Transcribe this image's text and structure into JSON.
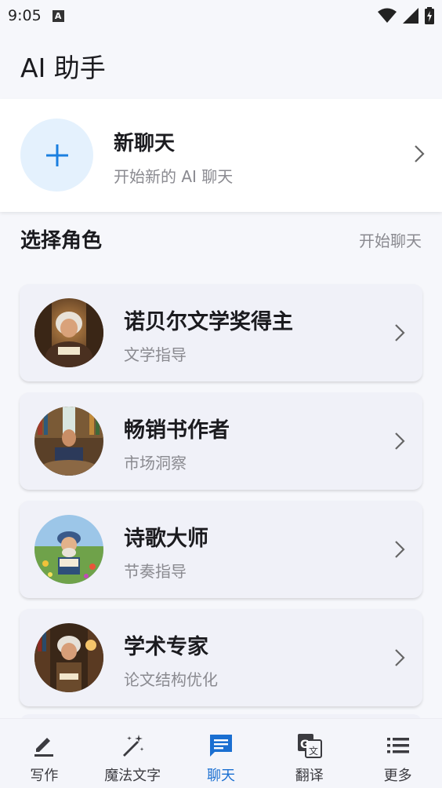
{
  "status_bar": {
    "time": "9:05",
    "notification_glyph": "A"
  },
  "header": {
    "title": "AI 助手"
  },
  "new_chat": {
    "title": "新聊天",
    "subtitle": "开始新的 AI 聊天",
    "icon": "plus-icon"
  },
  "section": {
    "title": "选择角色",
    "action": "开始聊天"
  },
  "roles": [
    {
      "name": "诺贝尔文学奖得主",
      "desc": "文学指导",
      "avatar": "nobel-laureate-avatar"
    },
    {
      "name": "畅销书作者",
      "desc": "市场洞察",
      "avatar": "bestseller-author-avatar"
    },
    {
      "name": "诗歌大师",
      "desc": "节奏指导",
      "avatar": "poetry-master-avatar"
    },
    {
      "name": "学术专家",
      "desc": "论文结构优化",
      "avatar": "academic-expert-avatar"
    }
  ],
  "nav": [
    {
      "label": "写作",
      "icon": "pen-icon",
      "active": false
    },
    {
      "label": "魔法文字",
      "icon": "magic-wand-icon",
      "active": false
    },
    {
      "label": "聊天",
      "icon": "chat-icon",
      "active": true
    },
    {
      "label": "翻译",
      "icon": "translate-icon",
      "active": false
    },
    {
      "label": "更多",
      "icon": "list-icon",
      "active": false
    }
  ],
  "colors": {
    "accent": "#1a6fd1",
    "plus_bg": "#e4f1fd",
    "card_bg": "#f0f1f8",
    "page_bg": "#f6f7fb"
  }
}
